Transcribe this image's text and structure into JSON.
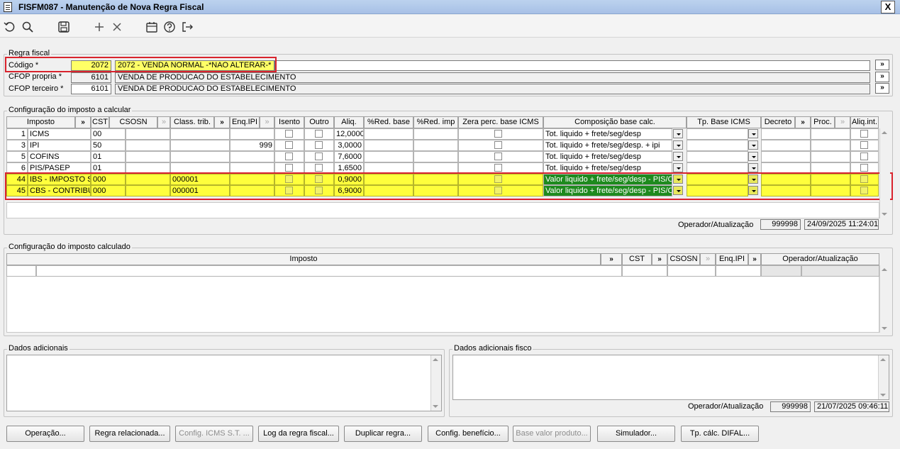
{
  "window": {
    "title": "FISFM087 - Manutenção de Nova Regra Fiscal",
    "close": "X"
  },
  "toolbar": {
    "icons": [
      "undo-icon",
      "search-icon",
      "save-icon",
      "add-icon",
      "delete-icon",
      "calendar-icon",
      "help-icon",
      "exit-icon"
    ]
  },
  "regra": {
    "group_title": "Regra fiscal",
    "codigo_label": "Código *",
    "codigo_value": "2072",
    "codigo_desc": "2072 - VENDA NORMAL -*NAO ALTERAR-*",
    "cfop_propria_label": "CFOP propria *",
    "cfop_propria_value": "6101",
    "cfop_propria_desc": "VENDA DE PRODUCAO DO ESTABELECIMENTO",
    "cfop_terceiro_label": "CFOP terceiro *",
    "cfop_terceiro_value": "6101",
    "cfop_terceiro_desc": "VENDA DE PRODUCAO DO ESTABELECIMENTO",
    "more": "»"
  },
  "calc": {
    "group_title": "Configuração do imposto a calcular",
    "headers": {
      "imposto": "Imposto",
      "cst": "CST",
      "csosn": "CSOSN",
      "class": "Class. trib.",
      "enq": "Enq.IPI",
      "isento": "Isento",
      "outro": "Outro",
      "aliq": "Aliq.",
      "redbase": "%Red. base",
      "redimp": "%Red. imp",
      "zera": "Zera perc. base ICMS",
      "comp": "Composição base calc.",
      "tpbase": "Tp. Base ICMS",
      "decreto": "Decreto",
      "proc": "Proc.",
      "aliqint": "Aliq.int.",
      "more": "»"
    },
    "rows": [
      {
        "id": "1",
        "imposto": "ICMS",
        "cst": "00",
        "class": "",
        "enq": "",
        "aliq": "12,0000",
        "comp": "Tot. liquido + frete/seg/desp"
      },
      {
        "id": "3",
        "imposto": "IPI",
        "cst": "50",
        "class": "",
        "enq": "999",
        "aliq": "3,0000",
        "comp": "Tot. liquido + frete/seg/desp. + ipi"
      },
      {
        "id": "5",
        "imposto": "COFINS",
        "cst": "01",
        "class": "",
        "enq": "",
        "aliq": "7,6000",
        "comp": "Tot. liquido + frete/seg/desp"
      },
      {
        "id": "6",
        "imposto": "PIS/PASEP",
        "cst": "01",
        "class": "",
        "enq": "",
        "aliq": "1,6500",
        "comp": "Tot. liquido + frete/seg/desp"
      },
      {
        "id": "44",
        "imposto": "IBS - IMPOSTO SO",
        "cst": "000",
        "class": "000001",
        "enq": "",
        "aliq": "0,9000",
        "comp": "Valor liquido + frete/seg/desp - PIS/COFINS"
      },
      {
        "id": "45",
        "imposto": "CBS - CONTRIBUIÇ",
        "cst": "000",
        "class": "000001",
        "enq": "",
        "aliq": "6,9000",
        "comp": "Valor liquido + frete/seg/desp - PIS/COFINS"
      }
    ],
    "operador_label": "Operador/Atualização",
    "operador_value": "999998",
    "operador_date": "24/09/2025 11:24:01"
  },
  "calculado": {
    "group_title": "Configuração do imposto calculado",
    "headers": {
      "imposto": "Imposto",
      "cst": "CST",
      "csosn": "CSOSN",
      "enq": "Enq.IPI",
      "operador": "Operador/Atualização",
      "more": "»"
    }
  },
  "dados": {
    "title": "Dados adicionais"
  },
  "dados_fisco": {
    "title": "Dados adicionais fisco",
    "operador_label": "Operador/Atualização",
    "operador_value": "999998",
    "operador_date": "21/07/2025 09:46:11"
  },
  "buttons": {
    "operacao": "Operação...",
    "regra_rel": "Regra relacionada...",
    "config_icms": "Config. ICMS S.T. ...",
    "log": "Log da regra fiscal...",
    "duplicar": "Duplicar regra...",
    "config_beneficio": "Config. benefício...",
    "base_valor": "Base valor produto...",
    "simulador": "Simulador...",
    "tp_calc": "Tp. cálc. DIFAL..."
  }
}
